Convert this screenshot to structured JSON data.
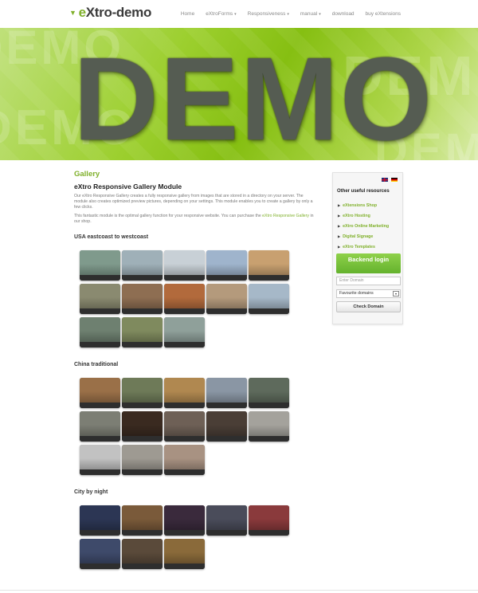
{
  "header": {
    "logo": {
      "prefix": "e",
      "text": "Xtro-demo"
    },
    "nav": [
      {
        "label": "Home",
        "has_caret": false
      },
      {
        "label": "eXtroForms",
        "has_caret": true
      },
      {
        "label": "Responsiveness",
        "has_caret": true
      },
      {
        "label": "manual",
        "has_caret": true
      },
      {
        "label": "download",
        "has_caret": false
      },
      {
        "label": "buy eXtensions",
        "has_caret": false
      }
    ],
    "caret": "▾"
  },
  "banner": {
    "text": "DEMO",
    "ghost_text": "DEMO",
    "color": "#8bc21a"
  },
  "main": {
    "title": "Gallery",
    "module_title": "eXtro Responsive Gallery Module",
    "para1": "Our eXtro Responsive Gallery creates a fully responsive gallery from images that are stored in a directory on your server. The module also creates optimized preview pictures, depending on your settings. This module enables you to create a gallery by only a few clicks.",
    "para2_before": "This fantastic module is the optimal gallery function for your responsive website. You can purchase the ",
    "para2_link": "eXtro Responsive Gallery",
    "para2_after": " in our shop.",
    "sections": [
      {
        "title": "USA eastcoast to westcoast",
        "count": 13,
        "tones": [
          "#7f9a8c",
          "#9fb0b8",
          "#c8d0d6",
          "#9fb4cc",
          "#c8a070",
          "#8a8a70",
          "#8e6e52",
          "#b26a3c",
          "#b49a7c",
          "#a6b8c8",
          "#6e8070",
          "#7f8a5e",
          "#8fa09a"
        ]
      },
      {
        "title": "China traditional",
        "count": 13,
        "tones": [
          "#9a7048",
          "#6e7a58",
          "#b08850",
          "#8a96a4",
          "#5e6a5c",
          "#7c7e74",
          "#3a2a20",
          "#6e6056",
          "#4a3e36",
          "#a4a29c",
          "#c2c2c2",
          "#9e9a92",
          "#a89282"
        ]
      },
      {
        "title": "City by night",
        "count": 8,
        "tones": [
          "#2c3654",
          "#7a5a3a",
          "#3a2a3c",
          "#4a4c5a",
          "#8a3a3c",
          "#3e4a6a",
          "#5a4a3a",
          "#8a6a3a"
        ]
      }
    ]
  },
  "sidebar": {
    "title": "Other useful resources",
    "arrow": "▶",
    "items": [
      "eXtensions Shop",
      "eXtro Hosting",
      "eXtro Online Marketing",
      "Digital Signage",
      "eXtro Templates"
    ],
    "backend_label": "Backend login",
    "domain_placeholder": "Enter Domain",
    "domain_select": "Favourite domains",
    "dropdown_icon": "▾",
    "check_label": "Check Domain"
  }
}
